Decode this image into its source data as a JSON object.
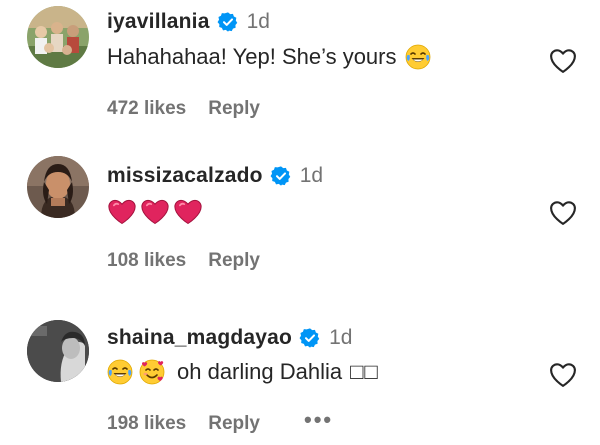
{
  "comments": [
    {
      "username": "iyavillania",
      "time": "1d",
      "text": "Hahahahaa! Yep! She’s yours",
      "trailing_emoji": "face-with-tears-of-joy",
      "likes": "472 likes",
      "reply": "Reply"
    },
    {
      "username": "missizacalzado",
      "time": "1d",
      "emojis": [
        "red-heart",
        "red-heart",
        "red-heart"
      ],
      "likes": "108 likes",
      "reply": "Reply"
    },
    {
      "username": "shaina_magdayao",
      "time": "1d",
      "leading_emojis": [
        "face-with-tears-of-joy",
        "smiling-face-with-hearts"
      ],
      "text": "oh darling Dahlia",
      "trailing_glyphs": "□□",
      "likes": "198 likes",
      "reply": "Reply",
      "more": "•••"
    }
  ],
  "colors": {
    "text": "#262626",
    "secondary": "#737373",
    "verified": "#0095f6",
    "heart_emoji": "#e0245e"
  },
  "icons": {
    "verified": "verified-badge-icon",
    "like": "heart-outline-icon"
  }
}
